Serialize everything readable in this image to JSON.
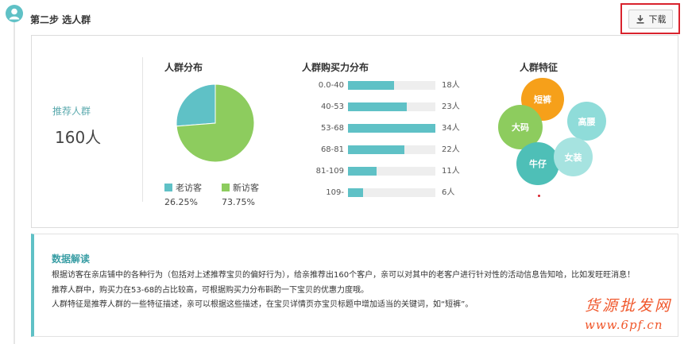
{
  "step": {
    "title": "第二步 选人群"
  },
  "toolbar": {
    "download_label": "下载",
    "download_icon": "download-icon"
  },
  "recommend": {
    "label": "推荐人群",
    "count": "160人"
  },
  "sections": {
    "crowd_dist_title": "人群分布",
    "purchase_title": "人群购买力分布",
    "features_title": "人群特征"
  },
  "chart_data": [
    {
      "type": "pie",
      "title": "人群分布",
      "categories": [
        "老访客",
        "新访客"
      ],
      "values": [
        26.25,
        73.75
      ],
      "labels": [
        "26.25%",
        "73.75%"
      ],
      "colors": [
        "#5fc1c6",
        "#8dcc5e"
      ]
    },
    {
      "type": "bar",
      "title": "人群购买力分布",
      "categories": [
        "0.0-40",
        "40-53",
        "53-68",
        "68-81",
        "81-109",
        "109-"
      ],
      "values": [
        18,
        23,
        34,
        22,
        11,
        6
      ],
      "value_labels": [
        "18人",
        "23人",
        "34人",
        "22人",
        "11人",
        "6人"
      ],
      "xlim": [
        0,
        34
      ],
      "color": "#5fc1c6",
      "track_color": "#eeeeee"
    }
  ],
  "features": [
    {
      "label": "短裤",
      "color": "#f6a01a"
    },
    {
      "label": "大码",
      "color": "#8dcc5e"
    },
    {
      "label": "高腰",
      "color": "#8fdcd9"
    },
    {
      "label": "牛仔",
      "color": "#4ebfb7"
    },
    {
      "label": "女装",
      "color": "#a6e3e0"
    }
  ],
  "interpretation": {
    "title": "数据解读",
    "lines": [
      "根据访客在亲店铺中的各种行为（包括对上述推荐宝贝的偏好行为），给亲推荐出160个客户，亲可以对其中的老客户进行针对性的活动信息告知哈，比如发旺旺消息！",
      "推荐人群中，购买力在53-68的占比较高，可根据购买力分布斟酌一下宝贝的优惠力度哦。",
      "人群特征是推荐人群的一些特征描述，亲可以根据这些描述，在宝贝详情页亦宝贝标题中增加适当的关键词，如“短裤”。"
    ]
  },
  "watermark": {
    "line1": "货源批发网",
    "line2": "www.6pf.cn"
  }
}
